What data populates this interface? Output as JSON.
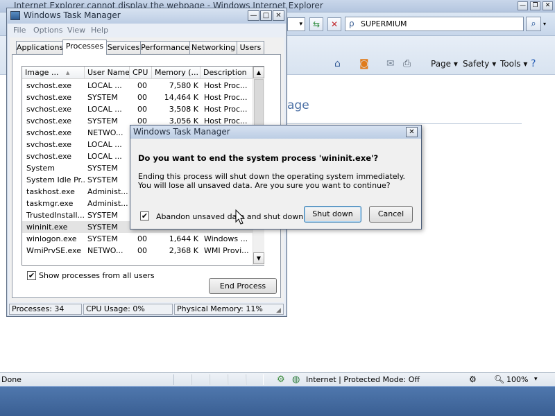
{
  "ie": {
    "title": "Internet Explorer cannot display the webpage - Windows Internet Explorer",
    "search_value": "SUPERMIUM",
    "commands": {
      "page": "Page",
      "safety": "Safety",
      "tools": "Tools"
    },
    "page_heading_partial": "age",
    "status_text": "Done",
    "zone_text": "Internet | Protected Mode: Off",
    "zoom_text": "100%"
  },
  "taskmgr": {
    "title": "Windows Task Manager",
    "menu": [
      "File",
      "Options",
      "View",
      "Help"
    ],
    "tabs": [
      "Applications",
      "Processes",
      "Services",
      "Performance",
      "Networking",
      "Users"
    ],
    "active_tab_index": 1,
    "columns": [
      "Image ...",
      "User Name",
      "CPU",
      "Memory (...",
      "Description"
    ],
    "rows": [
      [
        "svchost.exe",
        "LOCAL ...",
        "00",
        "7,580 K",
        "Host Proc..."
      ],
      [
        "svchost.exe",
        "SYSTEM",
        "00",
        "14,464 K",
        "Host Proc..."
      ],
      [
        "svchost.exe",
        "LOCAL ...",
        "00",
        "3,508 K",
        "Host Proc..."
      ],
      [
        "svchost.exe",
        "SYSTEM",
        "00",
        "3,056 K",
        "Host Proc..."
      ],
      [
        "svchost.exe",
        "NETWO...",
        "",
        "",
        ""
      ],
      [
        "svchost.exe",
        "LOCAL ...",
        "",
        "",
        ""
      ],
      [
        "svchost.exe",
        "LOCAL ...",
        "",
        "",
        ""
      ],
      [
        "System",
        "SYSTEM",
        "",
        "",
        ""
      ],
      [
        "System Idle Pr...",
        "SYSTEM",
        "",
        "",
        ""
      ],
      [
        "taskhost.exe",
        "Administ...",
        "",
        "",
        ""
      ],
      [
        "taskmgr.exe",
        "Administ...",
        "",
        "",
        ""
      ],
      [
        "TrustedInstall...",
        "SYSTEM",
        "",
        "",
        ""
      ],
      [
        "wininit.exe",
        "SYSTEM",
        "",
        "",
        ""
      ],
      [
        "winlogon.exe",
        "SYSTEM",
        "00",
        "1,644 K",
        "Windows ..."
      ],
      [
        "WmiPrvSE.exe",
        "NETWO...",
        "00",
        "2,368 K",
        "WMI Provi..."
      ]
    ],
    "selected_row_index": 12,
    "show_all_label": "Show processes from all users",
    "show_all_checked": true,
    "end_process_label": "End Process",
    "status": {
      "processes": "Processes: 34",
      "cpu": "CPU Usage: 0%",
      "memory": "Physical Memory: 11%"
    }
  },
  "dialog": {
    "title": "Windows Task Manager",
    "heading": "Do you want to end the system process 'wininit.exe'?",
    "body": "Ending this process will shut down the operating system immediately.  You will lose all unsaved data.  Are you sure you want to continue?",
    "abandon_label": "Abandon unsaved data and shut down.",
    "abandon_checked": true,
    "shutdown_label": "Shut down",
    "cancel_label": "Cancel"
  },
  "icons": {
    "checkmark": "✔",
    "close": "✕",
    "minimize": "—",
    "maximize": "□",
    "restore": "❐",
    "sort_up": "▲",
    "scroll_up": "▲",
    "scroll_down": "▼",
    "search": "🔍",
    "dropdown": "▾"
  }
}
